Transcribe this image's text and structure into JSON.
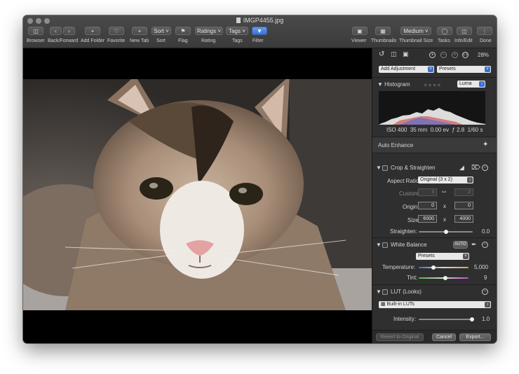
{
  "window": {
    "title": "IMGP4455.jpg"
  },
  "toolbar": {
    "browser": "Browser",
    "backforward": "Back/Forward",
    "addfolder": "Add Folder",
    "favorite": "Favorite",
    "newtab": "New Tab",
    "sort_btn": "Sort",
    "sort": "Sort",
    "flag": "Flag",
    "ratings_btn": "Ratings",
    "rating": "Rating",
    "tags_btn": "Tags",
    "tags": "Tags",
    "filter": "Filter",
    "viewer": "Viewer",
    "thumbnails": "Thumbnails",
    "thumbsize_btn": "Medium",
    "thumbsize": "Thumbnail Size",
    "tasks": "Tasks",
    "infoedit": "Info/Edit",
    "done": "Done"
  },
  "panel": {
    "zoom": "28%",
    "add_adjustment": "Add Adjustment",
    "presets": "Presets",
    "histogram": {
      "title": "Histogram",
      "mode": "Luma",
      "iso": "ISO 400",
      "focal": "35 mm",
      "ev": "0.00 ev",
      "aperture": "ƒ 2.8",
      "shutter": "1/60 s"
    },
    "auto_enhance": "Auto Enhance",
    "crop": {
      "title": "Crop & Straighten",
      "aspect_label": "Aspect Ratio:",
      "aspect_value": "Original (3 x 2)",
      "custom_label": "Custom:",
      "custom_w": "3",
      "custom_h": "2",
      "origin_label": "Origin:",
      "origin_x": "0",
      "origin_y": "0",
      "x_sep": "x",
      "size_label": "Size:",
      "size_w": "6000",
      "size_h": "4000",
      "straighten_label": "Straighten:",
      "straighten_value": "0.0",
      "straighten_level": 0.5
    },
    "wb": {
      "title": "White Balance",
      "auto": "AUTO",
      "presets": "Presets",
      "temp_label": "Temperature:",
      "temp_value": "5,000",
      "temp_level": 0.3,
      "tint_label": "Tint:",
      "tint_value": "9",
      "tint_level": 0.54
    },
    "lut": {
      "title": "LUT (Looks)",
      "builtin": "Built-in LUTs",
      "intensity_label": "Intensity:",
      "intensity_value": "1.0",
      "intensity_level": 1.0
    },
    "footer": {
      "revert": "Revert to Original",
      "cancel": "Cancel",
      "export": "Export..."
    }
  }
}
